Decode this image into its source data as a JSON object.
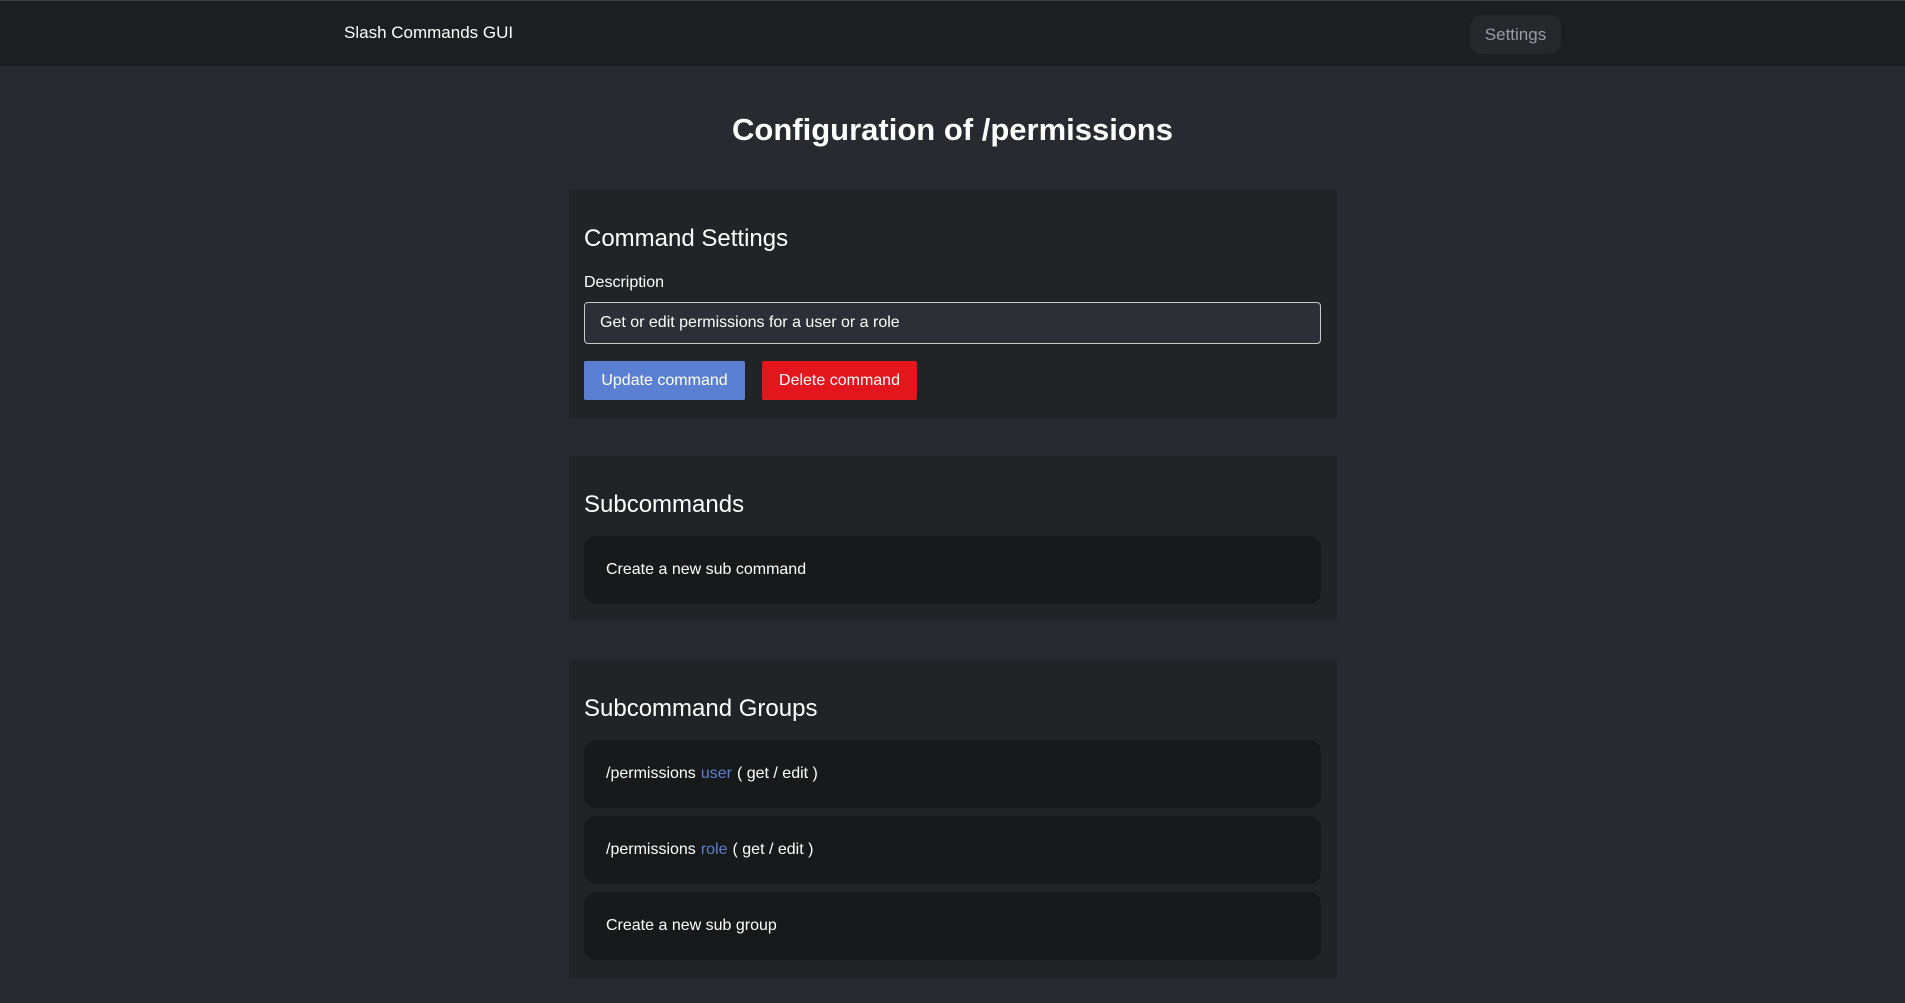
{
  "header": {
    "brand": "Slash Commands GUI",
    "settings_label": "Settings"
  },
  "page": {
    "title": "Configuration of /permissions"
  },
  "command_settings": {
    "title": "Command Settings",
    "description_label": "Description",
    "description_value": "Get or edit permissions for a user or a role",
    "update_label": "Update command",
    "delete_label": "Delete command"
  },
  "subcommands": {
    "title": "Subcommands",
    "create_label": "Create a new sub command"
  },
  "subcommand_groups": {
    "title": "Subcommand Groups",
    "groups": [
      {
        "prefix": "/permissions",
        "name": "user",
        "suffix": "( get / edit )"
      },
      {
        "prefix": "/permissions",
        "name": "role",
        "suffix": "( get / edit )"
      }
    ],
    "create_label": "Create a new sub group"
  },
  "colors": {
    "accent": "#5b80d2",
    "danger": "#e3161d",
    "background": "#282a2f",
    "navbar": "#1d1e21",
    "card": "#222327",
    "list_item": "#18191b"
  }
}
